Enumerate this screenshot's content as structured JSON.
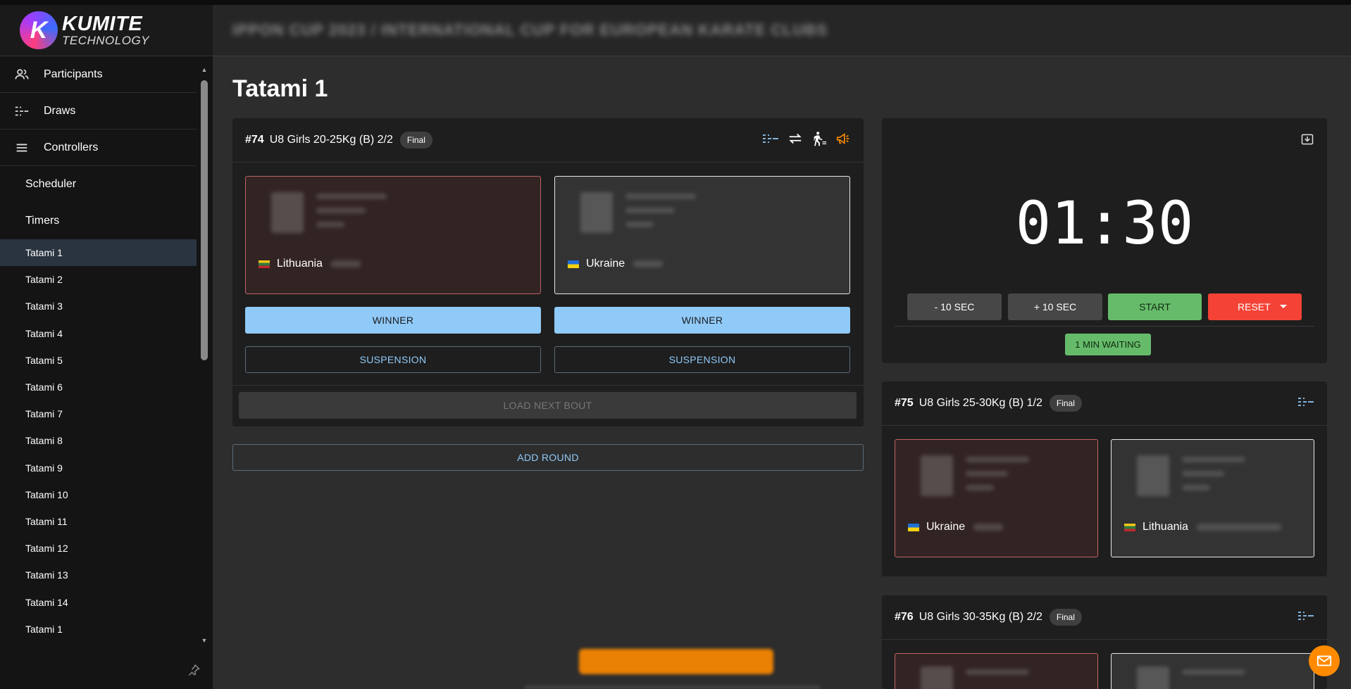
{
  "app": {
    "logo_mark": "K",
    "logo_line1": "KUMITE",
    "logo_line2": "TECHNOLOGY",
    "header_title": "IPPON CUP 2023 / INTERNATIONAL CUP FOR EUROPEAN KARATE CLUBS"
  },
  "sidebar": {
    "items": [
      {
        "label": "Participants",
        "icon": "people-icon"
      },
      {
        "label": "Draws",
        "icon": "bracket-icon"
      },
      {
        "label": "Controllers",
        "icon": "menu-icon"
      }
    ],
    "sub_items": [
      "Scheduler",
      "Timers"
    ],
    "tatamis": [
      "Tatami 1",
      "Tatami 2",
      "Tatami 3",
      "Tatami 4",
      "Tatami 5",
      "Tatami 6",
      "Tatami 7",
      "Tatami 8",
      "Tatami 9",
      "Tatami 10",
      "Tatami 11",
      "Tatami 12",
      "Tatami 13",
      "Tatami 14",
      "Tatami 1"
    ],
    "active_index": 0
  },
  "page": {
    "title": "Tatami 1"
  },
  "current_bout": {
    "number": "#74",
    "title": "U8 Girls 20-25Kg (B) 2/2",
    "badge": "Final",
    "red": {
      "country": "Lithuania"
    },
    "white": {
      "country": "Ukraine"
    },
    "winner_label": "WINNER",
    "suspension_label": "SUSPENSION",
    "load_next_label": "LOAD NEXT BOUT"
  },
  "add_round_label": "ADD ROUND",
  "timer": {
    "display": "01:30",
    "minus_label": "- 10 SEC",
    "plus_label": "+ 10 SEC",
    "start_label": "START",
    "reset_label": "RESET",
    "waiting_label": "1 MIN WAITING"
  },
  "upcoming": [
    {
      "number": "#75",
      "title": "U8 Girls 25-30Kg (B) 1/2",
      "badge": "Final",
      "red_country": "Ukraine",
      "white_country": "Lithuania"
    },
    {
      "number": "#76",
      "title": "U8 Girls 30-35Kg (B) 2/2",
      "badge": "Final"
    }
  ],
  "colors": {
    "accent_blue": "#90caf9",
    "start_green": "#66bb6a",
    "reset_red": "#f44336",
    "warning_orange": "#ff8a00"
  }
}
